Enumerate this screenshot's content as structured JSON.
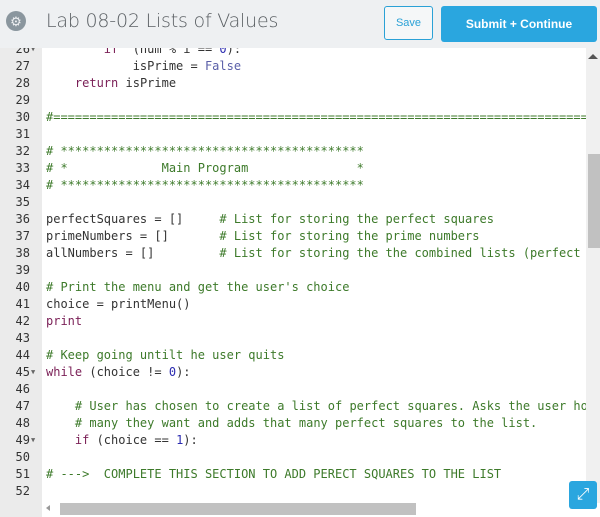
{
  "header": {
    "settings_icon": "gear-icon",
    "title": "Lab 08-02 Lists of Values",
    "save_label": "Save",
    "submit_label": "Submit + Continue"
  },
  "colors": {
    "accent": "#2aa6df",
    "comment": "#3d7a2a",
    "keyword": "#7a1f56",
    "number": "#2b2bb0"
  },
  "editor": {
    "lines": [
      {
        "n": "26",
        "fold": true,
        "indent": "        ",
        "parts": [
          [
            "kw",
            "if"
          ],
          [
            "",
            "  (num % i == "
          ],
          [
            "num",
            "0"
          ],
          [
            "",
            "):"
          ]
        ]
      },
      {
        "n": "27",
        "fold": false,
        "indent": "            ",
        "parts": [
          [
            "",
            "isPrime = "
          ],
          [
            "bi",
            "False"
          ]
        ]
      },
      {
        "n": "28",
        "fold": false,
        "indent": "    ",
        "parts": [
          [
            "kw",
            "return"
          ],
          [
            "",
            " isPrime"
          ]
        ]
      },
      {
        "n": "29",
        "fold": false,
        "indent": "",
        "parts": []
      },
      {
        "n": "30",
        "fold": false,
        "indent": "",
        "parts": [
          [
            "cm",
            "#==================================================================================="
          ]
        ]
      },
      {
        "n": "31",
        "fold": false,
        "indent": "",
        "parts": []
      },
      {
        "n": "32",
        "fold": false,
        "indent": "",
        "parts": [
          [
            "cm",
            "# ******************************************"
          ]
        ]
      },
      {
        "n": "33",
        "fold": false,
        "indent": "",
        "parts": [
          [
            "cm",
            "# *             Main Program               *"
          ]
        ]
      },
      {
        "n": "34",
        "fold": false,
        "indent": "",
        "parts": [
          [
            "cm",
            "# ******************************************"
          ]
        ]
      },
      {
        "n": "35",
        "fold": false,
        "indent": "",
        "parts": []
      },
      {
        "n": "36",
        "fold": false,
        "indent": "",
        "parts": [
          [
            "",
            "perfectSquares = []     "
          ],
          [
            "cm",
            "# List for storing the perfect squares"
          ]
        ]
      },
      {
        "n": "37",
        "fold": false,
        "indent": "",
        "parts": [
          [
            "",
            "primeNumbers = []       "
          ],
          [
            "cm",
            "# List for storing the prime numbers"
          ]
        ]
      },
      {
        "n": "38",
        "fold": false,
        "indent": "",
        "parts": [
          [
            "",
            "allNumbers = []         "
          ],
          [
            "cm",
            "# List for storing the the combined lists (perfect squares and primes)"
          ]
        ]
      },
      {
        "n": "39",
        "fold": false,
        "indent": "",
        "parts": []
      },
      {
        "n": "40",
        "fold": false,
        "indent": "",
        "parts": [
          [
            "cm",
            "# Print the menu and get the user's choice"
          ]
        ]
      },
      {
        "n": "41",
        "fold": false,
        "indent": "",
        "parts": [
          [
            "",
            "choice = printMenu()"
          ]
        ]
      },
      {
        "n": "42",
        "fold": false,
        "indent": "",
        "parts": [
          [
            "kw",
            "print"
          ]
        ]
      },
      {
        "n": "43",
        "fold": false,
        "indent": "",
        "parts": []
      },
      {
        "n": "44",
        "fold": false,
        "indent": "",
        "parts": [
          [
            "cm",
            "# Keep going untilt he user quits"
          ]
        ]
      },
      {
        "n": "45",
        "fold": true,
        "indent": "",
        "parts": [
          [
            "kw",
            "while"
          ],
          [
            "",
            " (choice != "
          ],
          [
            "num",
            "0"
          ],
          [
            "",
            "):"
          ]
        ]
      },
      {
        "n": "46",
        "fold": false,
        "indent": "",
        "parts": []
      },
      {
        "n": "47",
        "fold": false,
        "indent": "    ",
        "parts": [
          [
            "cm",
            "# User has chosen to create a list of perfect squares. Asks the user how"
          ]
        ]
      },
      {
        "n": "48",
        "fold": false,
        "indent": "    ",
        "parts": [
          [
            "cm",
            "# many they want and adds that many perfect squares to the list."
          ]
        ]
      },
      {
        "n": "49",
        "fold": true,
        "indent": "    ",
        "parts": [
          [
            "kw",
            "if"
          ],
          [
            "",
            " (choice == "
          ],
          [
            "num",
            "1"
          ],
          [
            "",
            "):"
          ]
        ]
      },
      {
        "n": "50",
        "fold": false,
        "indent": "",
        "parts": []
      },
      {
        "n": "51",
        "fold": false,
        "indent": "",
        "parts": [
          [
            "cm",
            "# --->  COMPLETE THIS SECTION TO ADD PERECT SQUARES TO THE LIST"
          ]
        ]
      },
      {
        "n": "52",
        "fold": false,
        "indent": "",
        "parts": []
      }
    ],
    "expand_icon": "expand-arrows-icon"
  }
}
